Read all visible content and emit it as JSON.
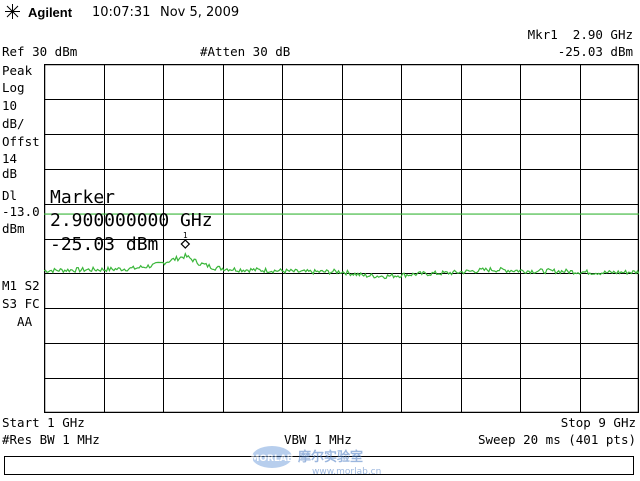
{
  "header": {
    "brand": "Agilent",
    "time": "10:07:31",
    "date": "Nov 5, 2009"
  },
  "marker_readout": {
    "label": "Mkr1  2.90 GHz",
    "amplitude": "-25.03 dBm"
  },
  "settings": {
    "ref": "Ref 30 dBm",
    "atten": "#Atten 30 dB"
  },
  "left_panel": {
    "scale_lines": [
      "Peak",
      "Log",
      "10",
      "dB/",
      "Offst",
      "14",
      "dB"
    ],
    "display_line_lines": [
      "Dl",
      "-13.0",
      "dBm"
    ],
    "mode_lines": [
      "M1 S2",
      "S3 FC",
      "  AA"
    ]
  },
  "marker_overlay": {
    "title": "Marker",
    "frequency": "2.900000000 GHz",
    "amplitude": "-25.03 dBm",
    "marker_number": "1"
  },
  "footer": {
    "start": "Start 1 GHz",
    "stop": "Stop 9 GHz",
    "rbw": "#Res BW 1 MHz",
    "vbw": "VBW 1 MHz",
    "sweep": "Sweep 20 ms (401 pts)"
  },
  "watermark": {
    "logo_text": "MORLAB",
    "cn_text": "摩尔实验室",
    "url": "www.morlab.cn"
  },
  "chart_data": {
    "type": "line",
    "x_start_ghz": 1,
    "x_stop_ghz": 9,
    "points": 401,
    "ylim": [
      -70,
      30
    ],
    "y_divisions_db": 10,
    "display_line_dbm": -13.0,
    "marker": {
      "freq_ghz": 2.9,
      "amp_dbm": -25.03
    },
    "trace_dbm": [
      [
        1.0,
        -29.2
      ],
      [
        1.4,
        -29.0
      ],
      [
        1.8,
        -28.9
      ],
      [
        2.2,
        -28.6
      ],
      [
        2.5,
        -27.6
      ],
      [
        2.7,
        -26.3
      ],
      [
        2.9,
        -25.03
      ],
      [
        3.1,
        -27.2
      ],
      [
        3.3,
        -28.4
      ],
      [
        3.6,
        -28.9
      ],
      [
        4.0,
        -29.1
      ],
      [
        4.5,
        -29.6
      ],
      [
        5.0,
        -29.5
      ],
      [
        5.3,
        -30.6
      ],
      [
        5.6,
        -30.8
      ],
      [
        6.0,
        -30.2
      ],
      [
        6.5,
        -29.8
      ],
      [
        7.0,
        -28.9
      ],
      [
        7.5,
        -29.3
      ],
      [
        8.0,
        -29.4
      ],
      [
        8.5,
        -29.8
      ],
      [
        9.0,
        -29.6
      ]
    ],
    "colors": {
      "trace": "#3ab63a",
      "display_line": "#3ab63a",
      "grid": "#000000"
    }
  }
}
